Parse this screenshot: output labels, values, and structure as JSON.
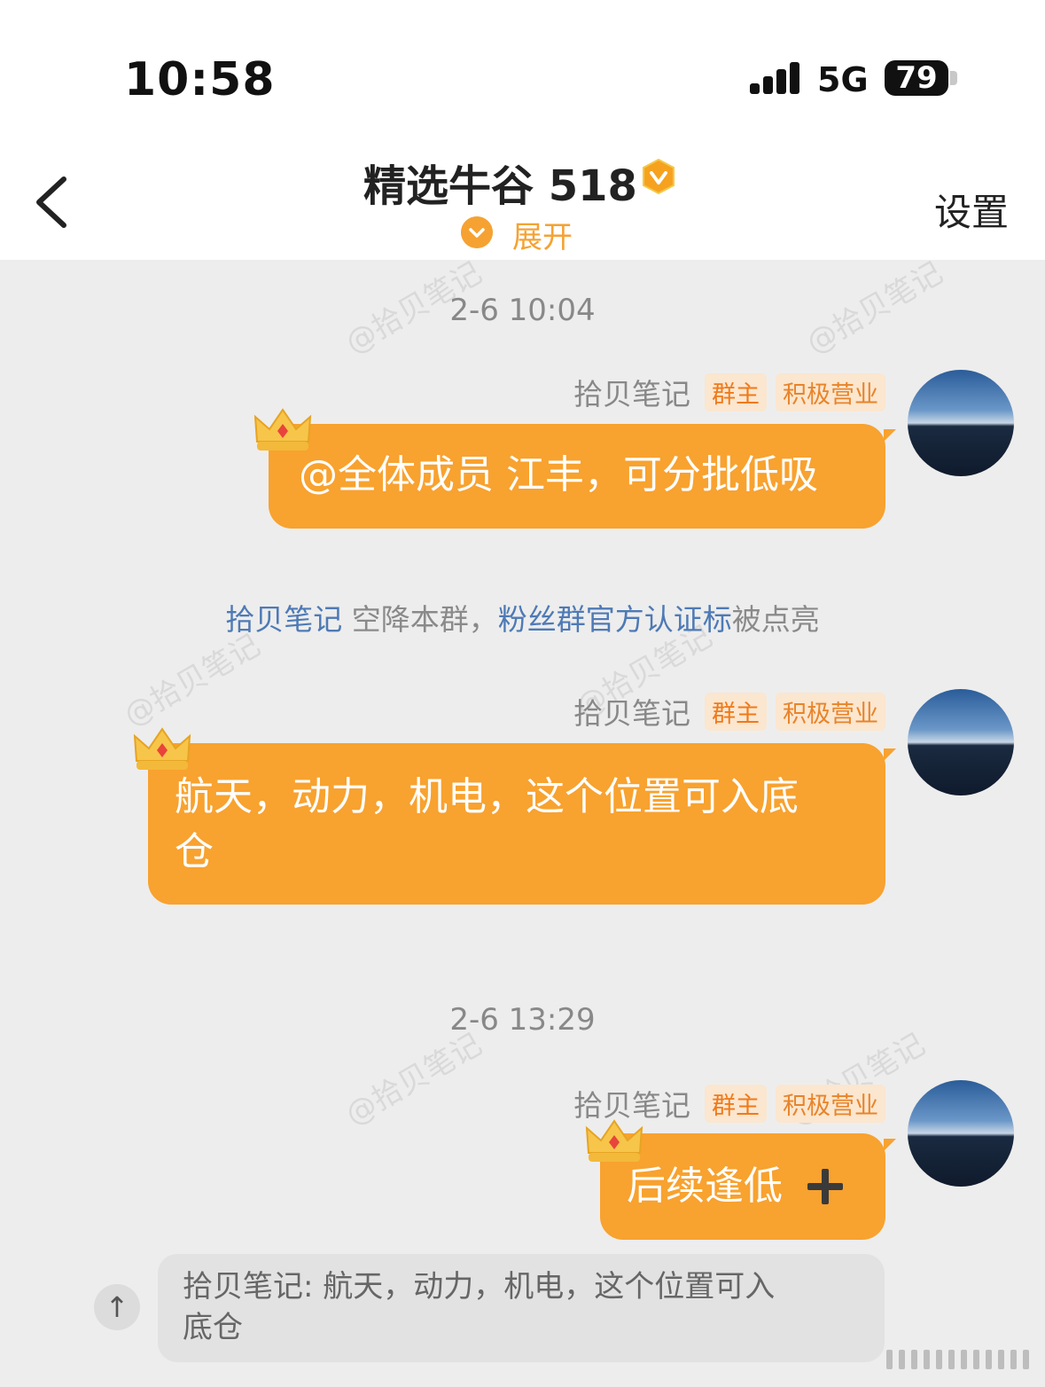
{
  "status_bar": {
    "time": "10:58",
    "network": "5G",
    "battery": "79"
  },
  "header": {
    "title": "精选牛谷 518",
    "expand_label": "展开",
    "settings_label": "设置"
  },
  "watermark_text": "@拾贝笔记",
  "messages": [
    {
      "timestamp": "2-6 10:04"
    },
    {
      "sender": "拾贝笔记",
      "tags": [
        "群主",
        "积极营业"
      ],
      "text": "@全体成员 江丰，可分批低吸"
    },
    {
      "system": {
        "part1": "拾贝笔记",
        "part2": " 空降本群，",
        "part3": "粉丝群官方认证标",
        "part4": "被点亮"
      }
    },
    {
      "sender": "拾贝笔记",
      "tags": [
        "群主",
        "积极营业"
      ],
      "text_line1": "航天，动力，机电，这个位置可入底",
      "text_line2": "仓"
    },
    {
      "timestamp": "2-6 13:29"
    },
    {
      "sender": "拾贝笔记",
      "tags": [
        "群主",
        "积极营业"
      ],
      "text": "后续逢低",
      "icon": "plus-icon"
    }
  ],
  "quote": {
    "line1": "拾贝笔记: 航天，动力，机电，这个位置可入",
    "line2": "底仓"
  },
  "quote_button_icon": "↑"
}
